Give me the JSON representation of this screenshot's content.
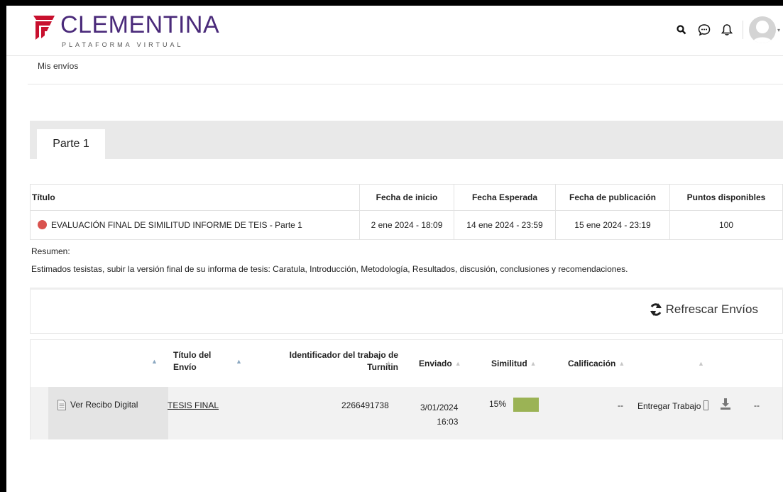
{
  "header": {
    "logo_text": "CLEMENTINA",
    "logo_subtitle": "PLATAFORMA VIRTUAL",
    "brand_color": "#4a2a7a",
    "accent_color": "#c8102e",
    "icons": [
      "search-icon",
      "chat-icon",
      "bell-icon",
      "avatar"
    ]
  },
  "breadcrumb": {
    "label": "Mis envíos"
  },
  "tabs": [
    {
      "label": "Parte 1"
    }
  ],
  "assignment": {
    "headers": [
      "Título",
      "Fecha de inicio",
      "Fecha Esperada",
      "Fecha de publicación",
      "Puntos disponibles"
    ],
    "title": "EVALUACIÓN FINAL DE SIMILITUD INFORME DE TEIS - Parte 1",
    "start": "2 ene 2024 - 18:09",
    "due": "14 ene 2024 - 23:59",
    "post": "15 ene 2024 - 23:19",
    "points": "100",
    "status_color": "#d9534f"
  },
  "summary": {
    "label": "Resumen:",
    "text": "Estimados tesistas, subir la versión final de su informa de tesis: Caratula, Introducción, Metodología, Resultados, discusión, conclusiones y recomendaciones."
  },
  "refresh": {
    "label": "Refrescar Envíos"
  },
  "submissions": {
    "headers": {
      "title_line1": "Título del",
      "title_line2": "Envío",
      "id_line1": "Identificador del trabajo de",
      "id_line2": "Turnitin",
      "submitted": "Enviado",
      "similarity": "Similitud",
      "grade": "Calificación"
    },
    "row": {
      "receipt": "Ver Recibo Digital",
      "title": "TESIS FINAL",
      "paper_id": "2266491738",
      "date": "3/01/2024",
      "time": "16:03",
      "similarity": "15%",
      "similarity_color": "#9bb355",
      "grade": "--",
      "submit": "Entregar Trabajo",
      "last": "--"
    }
  }
}
